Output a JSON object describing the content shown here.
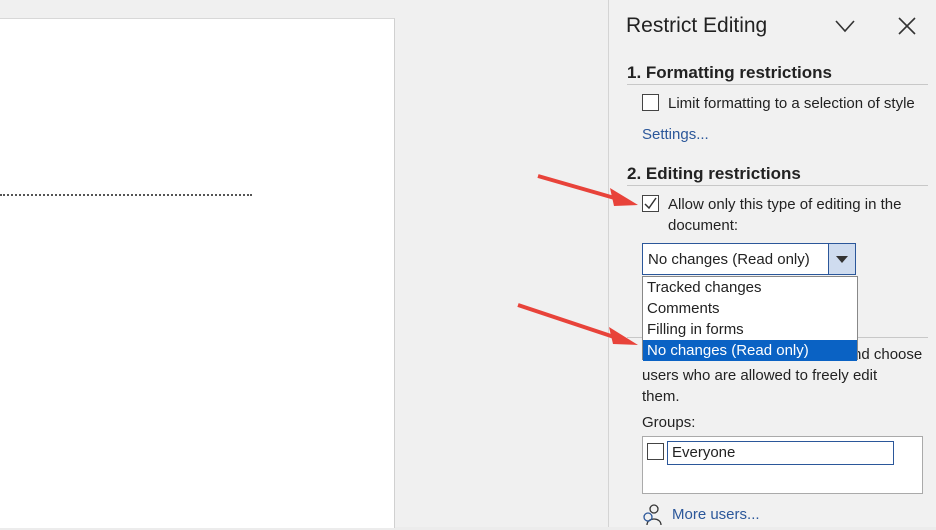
{
  "pane": {
    "title": "Restrict Editing",
    "section1": {
      "heading": "1. Formatting restrictions",
      "checkbox_label": "Limit formatting to a selection of style",
      "checked": false,
      "settings_link": "Settings..."
    },
    "section2": {
      "heading": "2. Editing restrictions",
      "checkbox_label_line1": "Allow only this type of editing in the",
      "checkbox_label_line2": "document:",
      "checked": true,
      "select_value": "No changes (Read only)",
      "options": [
        "Tracked changes",
        "Comments",
        "Filling in forms",
        "No changes (Read only)"
      ],
      "selected_option": "No changes (Read only)"
    },
    "exceptions": {
      "text_line1": "nd choose",
      "text_line2": "users who are allowed to freely edit",
      "text_line3": "them.",
      "groups_label": "Groups:",
      "everyone": "Everyone",
      "more_users": "More users..."
    }
  },
  "colors": {
    "link": "#2b579a",
    "selection": "#0a62c4",
    "arrow": "#e8433a"
  },
  "icons": [
    "chevron-down-icon",
    "close-icon",
    "person-icon"
  ]
}
